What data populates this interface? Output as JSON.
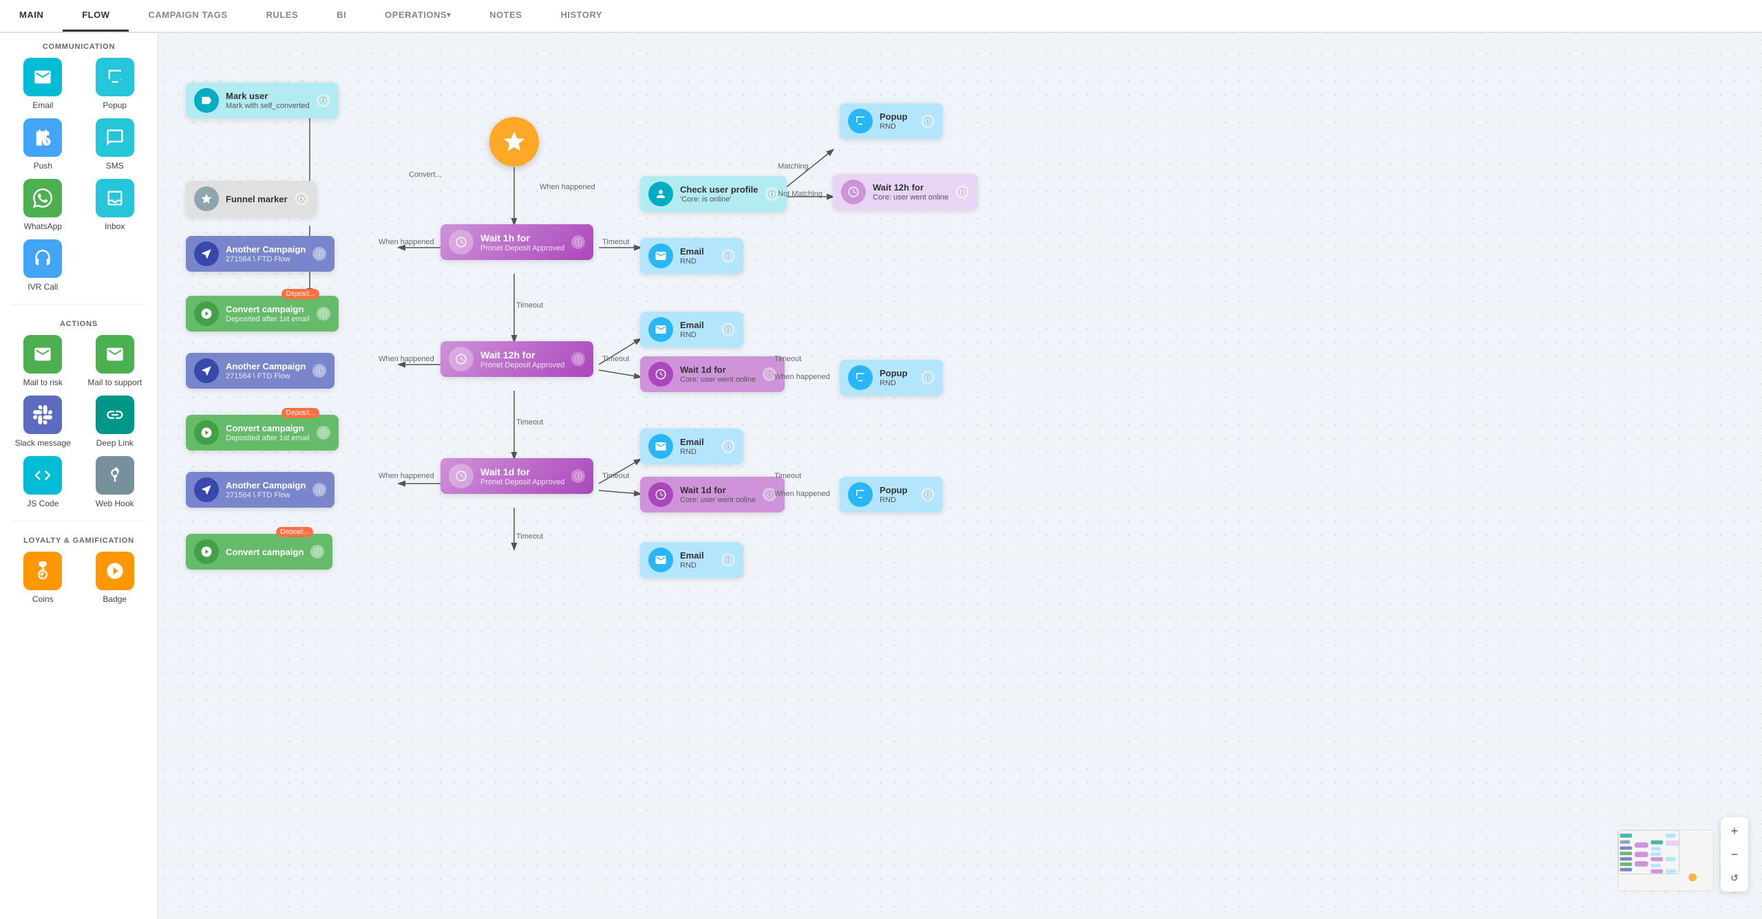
{
  "nav": {
    "tabs": [
      {
        "label": "MAIN",
        "active": false
      },
      {
        "label": "FLOW",
        "active": true
      },
      {
        "label": "CAMPAIGN TAGS",
        "active": false
      },
      {
        "label": "RULES",
        "active": false
      },
      {
        "label": "BI",
        "active": false
      },
      {
        "label": "OPERATIONS",
        "active": false,
        "arrow": true
      },
      {
        "label": "NOTES",
        "active": false
      },
      {
        "label": "HISTORY",
        "active": false
      }
    ]
  },
  "sidebar": {
    "sections": [
      {
        "title": "COMMUNICATION",
        "items": [
          {
            "label": "Email",
            "icon": "email",
            "color": "cyan"
          },
          {
            "label": "Popup",
            "icon": "popup",
            "color": "teal"
          },
          {
            "label": "Push",
            "icon": "push",
            "color": "blue"
          },
          {
            "label": "SMS",
            "icon": "sms",
            "color": "teal"
          },
          {
            "label": "WhatsApp",
            "icon": "whatsapp",
            "color": "green"
          },
          {
            "label": "Inbox",
            "icon": "inbox",
            "color": "teal"
          },
          {
            "label": "IVR Call",
            "icon": "ivrcall",
            "color": "blue"
          }
        ]
      },
      {
        "title": "ACTIONS",
        "items": [
          {
            "label": "Mail to risk",
            "icon": "mail",
            "color": "green"
          },
          {
            "label": "Mail to support",
            "icon": "mail",
            "color": "green"
          },
          {
            "label": "Slack message",
            "icon": "slack",
            "color": "indigo"
          },
          {
            "label": "Deep Link",
            "icon": "deeplink",
            "color": "teal2"
          },
          {
            "label": "JS Code",
            "icon": "jscode",
            "color": "cyan"
          },
          {
            "label": "Web Hook",
            "icon": "webhook",
            "color": "gray"
          }
        ]
      },
      {
        "title": "LOYALTY & GAMIFICATION",
        "items": [
          {
            "label": "Coins",
            "icon": "coins",
            "color": "orange"
          },
          {
            "label": "Badge",
            "icon": "badge",
            "color": "orange"
          }
        ]
      }
    ]
  },
  "flow": {
    "start_label": "★",
    "nodes": {
      "mark_user": {
        "title": "Mark user",
        "subtitle": "Mark with self_converted"
      },
      "funnel_marker": {
        "title": "Funnel marker"
      },
      "another_campaign_1": {
        "title": "Another Campaign",
        "subtitle": "271564 \\ FTD Flow"
      },
      "convert_1": {
        "title": "Convert campaign",
        "subtitle": "Deposited after 1st email"
      },
      "another_campaign_2": {
        "title": "Another Campaign",
        "subtitle": "271564 \\ FTD Flow"
      },
      "convert_2": {
        "title": "Convert campaign",
        "subtitle": "Deposited after 1st email"
      },
      "another_campaign_3": {
        "title": "Another Campaign",
        "subtitle": "271564 \\ FTD Flow"
      },
      "wait_1h": {
        "title": "Wait 1h for",
        "subtitle": "Pronet Deposit Approved"
      },
      "wait_12h": {
        "title": "Wait 12h for",
        "subtitle": "Pronet Deposit Approved"
      },
      "wait_1d_1": {
        "title": "Wait 1d for",
        "subtitle": "Pronet Deposit Approved"
      },
      "check_user": {
        "title": "Check user profile",
        "subtitle": "'Core: is online'"
      },
      "email_1": {
        "title": "Email",
        "subtitle": "RND"
      },
      "email_2": {
        "title": "Email",
        "subtitle": "RND"
      },
      "email_3": {
        "title": "Email",
        "subtitle": "RND"
      },
      "email_4": {
        "title": "Email",
        "subtitle": "RND"
      },
      "wait_1d_2": {
        "title": "Wait 1d for",
        "subtitle": "Core: user went online"
      },
      "wait_1d_3": {
        "title": "Wait 1d for",
        "subtitle": "Core: user went online"
      },
      "popup_1": {
        "title": "Popup",
        "subtitle": "RND"
      },
      "popup_2": {
        "title": "Popup",
        "subtitle": "RND"
      },
      "popup_3": {
        "title": "Popup",
        "subtitle": "RND"
      },
      "wait_12h_right": {
        "title": "Wait 12h for",
        "subtitle": "Core: user went online"
      }
    },
    "edge_labels": {
      "timeout": "Timeout",
      "when_happened": "When happened",
      "not_matching": "Not Matching",
      "matching": "Matching",
      "convert": "Convert...",
      "deposit": "Deposit..."
    }
  }
}
